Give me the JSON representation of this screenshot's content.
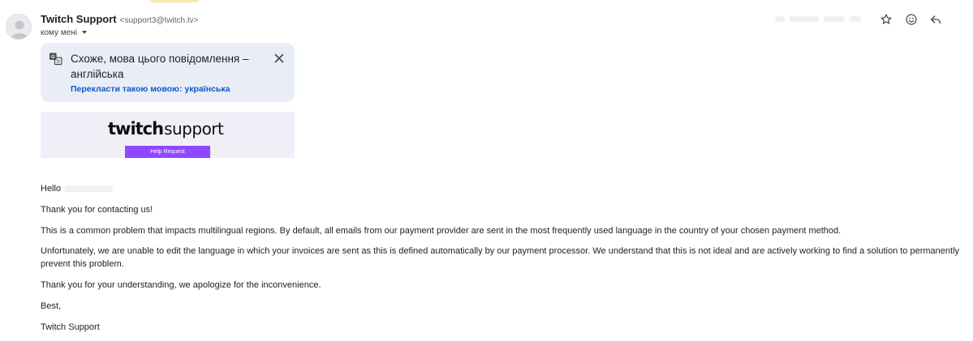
{
  "sender": {
    "name": "Twitch Support",
    "email": "<support3@twitch.tv>",
    "to_label": "кому мені"
  },
  "header_icons": [
    "star-icon",
    "emoji-icon",
    "reply-icon"
  ],
  "translate": {
    "message": "Схоже, мова цього повідомлення – англійська",
    "link": "Перекласти такою мовою: українська"
  },
  "banner": {
    "word_twitch": "twitch",
    "word_support": "support",
    "button": "Help Request"
  },
  "email_body": {
    "greeting": "Hello",
    "thanks": "Thank you for contacting us!",
    "para1": "This is a common problem that impacts multilingual regions. By default, all emails from our payment provider are sent in the most frequently used language in the country of your chosen payment method.",
    "para2": "Unfortunately, we are unable to edit the language in which your invoices are sent as this is defined automatically by our payment processor. We understand that this is not ideal and are actively working to find a solution to permanently prevent this problem.",
    "closing_thanks": "Thank you for your understanding, we apologize for the inconvenience.",
    "signoff": "Best,",
    "signature": "Twitch Support"
  },
  "colors": {
    "translate_bg": "#e9eef6",
    "link_blue": "#0b57d0",
    "twitch_purple": "#9147ff",
    "banner_bg": "#efeff7"
  }
}
